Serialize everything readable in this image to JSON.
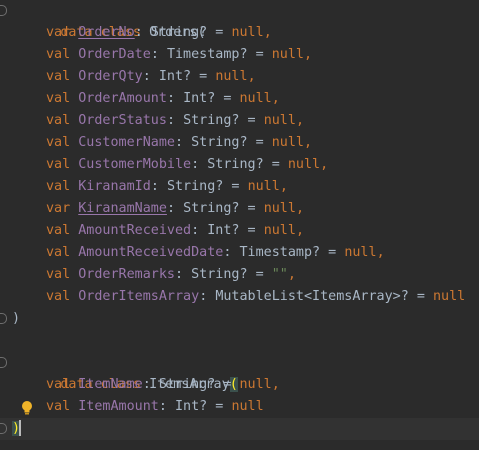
{
  "editor": {
    "lines": [
      {
        "kw": "data class",
        "name": "Orders",
        "open": "("
      },
      {
        "decl": "var",
        "prop": "OrderNo",
        "type": "String? = ",
        "value": "null",
        "end": ","
      },
      {
        "decl": "val",
        "prop": "OrderDate",
        "type": "Timestamp? = ",
        "value": "null",
        "end": ","
      },
      {
        "decl": "val",
        "prop": "OrderQty",
        "type": "Int? = ",
        "value": "null",
        "end": ","
      },
      {
        "decl": "val",
        "prop": "OrderAmount",
        "type": "Int? = ",
        "value": "null",
        "end": ","
      },
      {
        "decl": "val",
        "prop": "OrderStatus",
        "type": "String? = ",
        "value": "null",
        "end": ","
      },
      {
        "decl": "val",
        "prop": "CustomerName",
        "type": "String? = ",
        "value": "null",
        "end": ","
      },
      {
        "decl": "val",
        "prop": "CustomerMobile",
        "type": "String? = ",
        "value": "null",
        "end": ","
      },
      {
        "decl": "val",
        "prop": "KiranamId",
        "type": "String? = ",
        "value": "null",
        "end": ","
      },
      {
        "decl": "var",
        "prop": "KiranamName",
        "type": "String? = ",
        "value": "null",
        "end": ","
      },
      {
        "decl": "val",
        "prop": "AmountReceived",
        "type": "Int? = ",
        "value": "null",
        "end": ","
      },
      {
        "decl": "val",
        "prop": "AmountReceivedDate",
        "type": "Timestamp? = ",
        "value": "null",
        "end": ","
      },
      {
        "decl": "val",
        "prop": "OrderRemarks",
        "type": "String? = ",
        "value": "\"\"",
        "end": ","
      },
      {
        "decl": "val",
        "prop": "OrderItemsArray",
        "type": "MutableList<ItemsArray>? = ",
        "value": "null",
        "end": ""
      },
      {
        "close": ")"
      },
      {},
      {
        "kw": "data class",
        "name": "ItemsArray",
        "open": "("
      },
      {
        "decl": "val",
        "prop": "ItemName",
        "type": "String? = ",
        "value": "null",
        "end": ","
      },
      {
        "decl": "val",
        "prop": "ItemAmount",
        "type": "Int? = ",
        "value": "null",
        "end": ""
      },
      {
        "close": ")"
      }
    ],
    "colors": {
      "background": "#2b2b2b",
      "keyword": "#cc7832",
      "property": "#9876aa",
      "text": "#a9b7c6",
      "current_line": "#323232",
      "bulb": "#f0b429"
    },
    "icons": {
      "fold_marker": "fold-marker-icon",
      "intention": "lightbulb-icon"
    }
  }
}
